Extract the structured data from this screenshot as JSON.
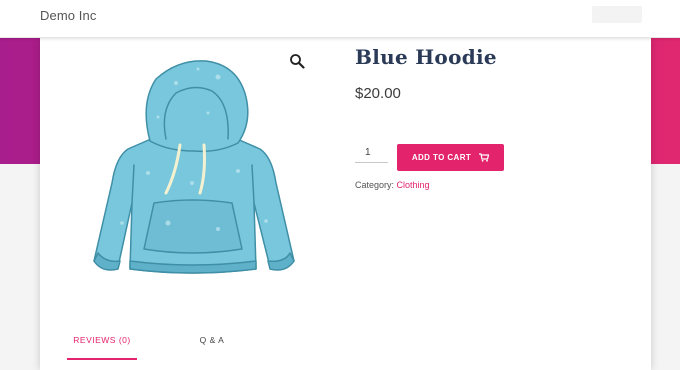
{
  "header": {
    "site_title": "Demo Inc"
  },
  "product": {
    "title": "Blue Hoodie",
    "price": "$20.00",
    "quantity": "1",
    "add_to_cart_label": "ADD TO CART",
    "category_label": "Category: ",
    "category_value": "Clothing",
    "image_icon": "zoom-magnifier-icon",
    "cart_icon": "shopping-cart-icon"
  },
  "tabs": [
    {
      "label": "REVIEWS (0)",
      "active": true
    },
    {
      "label": "Q & A",
      "active": false
    }
  ],
  "colors": {
    "accent": "#e3236b",
    "hero_gradient_start": "#a81e8c",
    "hero_gradient_end": "#e02870",
    "title": "#2b3a57",
    "hoodie": "#79c7dd"
  }
}
